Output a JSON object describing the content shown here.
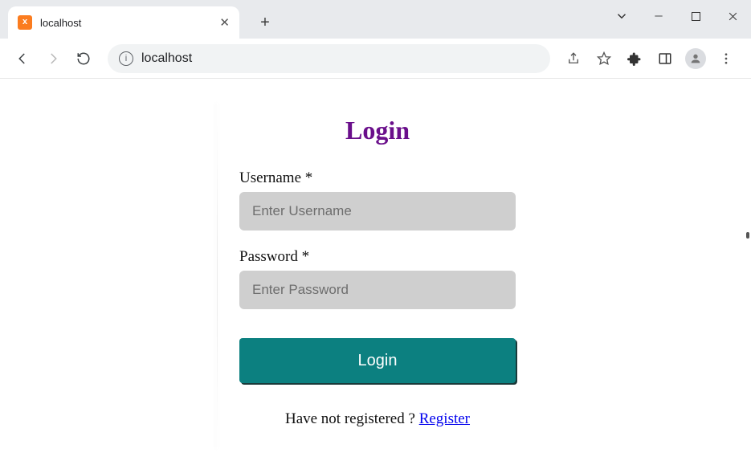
{
  "browser": {
    "tab_title": "localhost",
    "address": "localhost"
  },
  "page": {
    "title": "Login",
    "username_label": "Username *",
    "username_placeholder": "Enter Username",
    "password_label": "Password *",
    "password_placeholder": "Enter Password",
    "login_button": "Login",
    "register_prompt": "Have not registered ? ",
    "register_link": "Register"
  }
}
